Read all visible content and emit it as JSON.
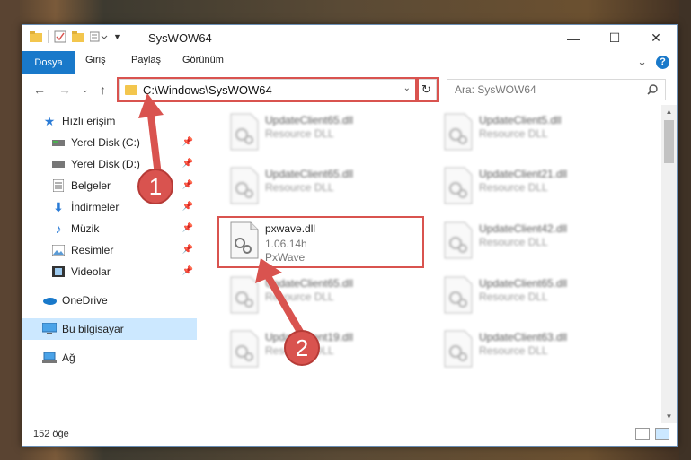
{
  "window": {
    "title": "SysWOW64",
    "minimize": "—",
    "maximize": "☐",
    "close": "✕"
  },
  "ribbon": {
    "file_tab": "Dosya",
    "tabs": [
      "Giriş",
      "Paylaş",
      "Görünüm"
    ],
    "expand": "⌄",
    "help": "?"
  },
  "address": {
    "path": "C:\\Windows\\SysWOW64",
    "dropdown": "⌄",
    "refresh": "↻"
  },
  "search": {
    "placeholder": "Ara: SysWOW64",
    "icon": "search-icon"
  },
  "sidebar": {
    "items": [
      {
        "label": "Hızlı erişim",
        "icon": "star-icon"
      },
      {
        "label": "Yerel Disk (C:)",
        "icon": "drive-icon",
        "pinned": true
      },
      {
        "label": "Yerel Disk (D:)",
        "icon": "drive-icon",
        "pinned": true
      },
      {
        "label": "Belgeler",
        "icon": "documents-icon",
        "pinned": true
      },
      {
        "label": "İndirmeler",
        "icon": "download-icon",
        "pinned": true
      },
      {
        "label": "Müzik",
        "icon": "music-icon",
        "pinned": true
      },
      {
        "label": "Resimler",
        "icon": "pictures-icon",
        "pinned": true
      },
      {
        "label": "Videolar",
        "icon": "video-icon",
        "pinned": true
      },
      {
        "label": "OneDrive",
        "icon": "cloud-icon"
      },
      {
        "label": "Bu bilgisayar",
        "icon": "computer-icon",
        "selected": true
      },
      {
        "label": "Ağ",
        "icon": "network-icon"
      }
    ]
  },
  "files": {
    "left": [
      {
        "name": "UpdateClient65.dll",
        "desc": "Resource DLL"
      },
      {
        "name": "UpdateClient65.dll",
        "desc": "Resource DLL"
      },
      {
        "name": "pxwave.dll",
        "version": "1.06.14h",
        "desc": "PxWave"
      },
      {
        "name": "UpdateClient65.dll",
        "desc": "Resource DLL"
      },
      {
        "name": "UpdateClient19.dll",
        "desc": "Resource DLL"
      }
    ],
    "right": [
      {
        "name": "UpdateClient5.dll",
        "desc": "Resource DLL"
      },
      {
        "name": "UpdateClient21.dll",
        "desc": "Resource DLL"
      },
      {
        "name": "UpdateClient42.dll",
        "desc": "Resource DLL"
      },
      {
        "name": "UpdateClient65.dll",
        "desc": "Resource DLL"
      },
      {
        "name": "UpdateClient63.dll",
        "desc": "Resource DLL"
      }
    ]
  },
  "status": {
    "count": "152 öğe"
  },
  "callouts": {
    "one": "1",
    "two": "2"
  },
  "colors": {
    "accent": "#1979ca",
    "highlight": "#d9534f",
    "selected": "#cce8ff"
  }
}
